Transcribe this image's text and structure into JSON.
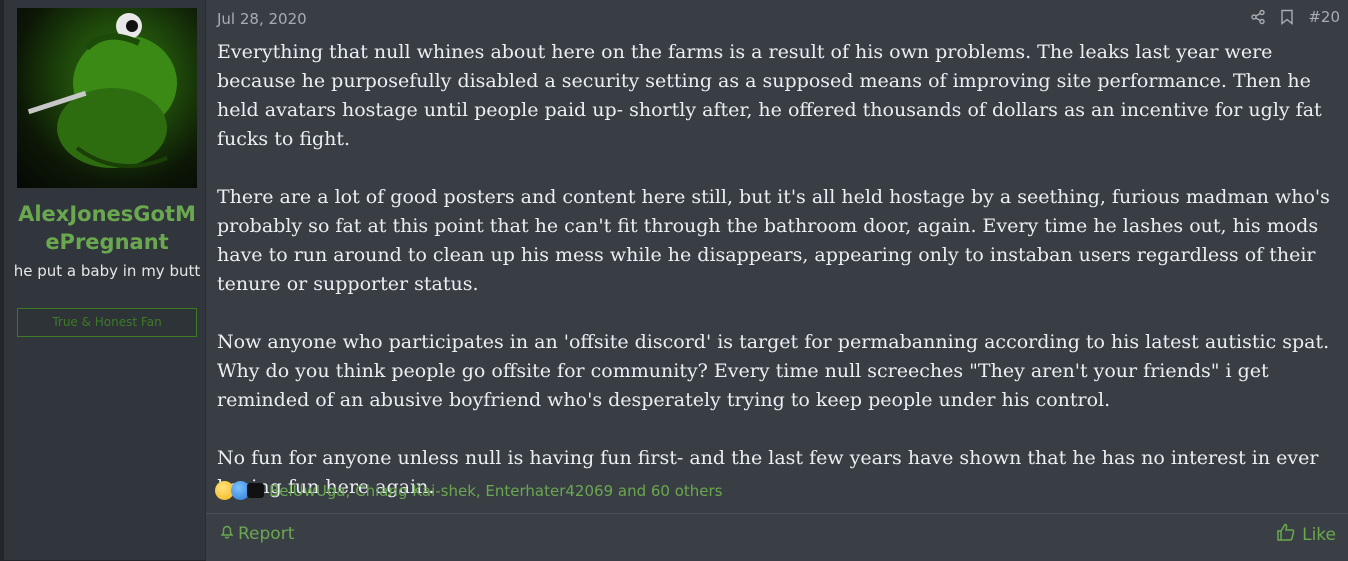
{
  "user": {
    "name": "AlexJonesGotMePregnant",
    "title": "he put a baby in my butt",
    "banner": "True & Honest Fan"
  },
  "post": {
    "date": "Jul 28, 2020",
    "number": "#20",
    "paragraphs": [
      "Everything that null whines about here on the farms is a result of his own problems. The leaks last year were because he purposefully disabled a security setting as a supposed means of improving site performance. Then he held avatars hostage until people paid up- shortly after, he offered thousands of dollars as an incentive for ugly fat fucks to fight.",
      "There are a lot of good posters and content here still, but it's all held hostage by a seething, furious madman who's probably so fat at this point that he can't fit through the bathroom door, again. Every time he lashes out, his mods have to run around to clean up his mess while he disappears, appearing only to instaban users regardless of their tenure or supporter status.",
      "Now anyone who participates in an 'offsite discord' is target for permabanning according to his latest autistic spat. Why do you think people go offsite for community? Every time null screeches \"They aren't your friends\" i get reminded of an abusive boyfriend who's desperately trying to keep people under his control.",
      "No fun for anyone unless null is having fun first- and the last few years have shown that he has no interest in ever having fun here again."
    ]
  },
  "reactions": {
    "icons": [
      "thinking-face-icon",
      "thumbs-up-icon",
      "top-hat-icon"
    ],
    "summary": "BelUwUga, Chiang Kai-shek, Enterhater42069 and 60 others"
  },
  "footer": {
    "report_label": "Report",
    "like_label": "Like"
  },
  "colors": {
    "accent": "#6aa84f",
    "background": "#393e45",
    "sidebar": "#31363d"
  }
}
